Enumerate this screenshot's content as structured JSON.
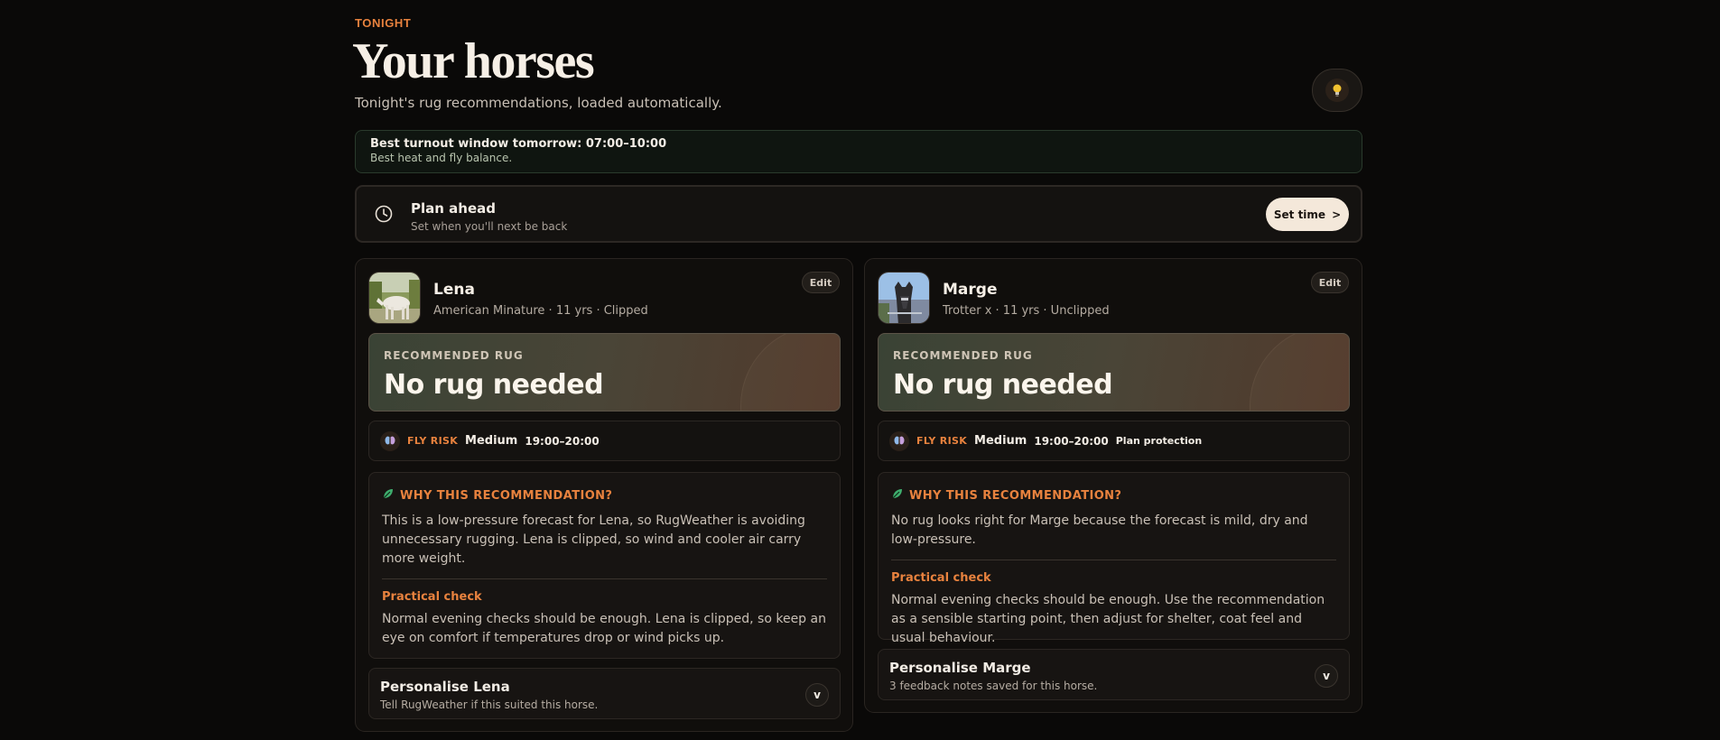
{
  "header": {
    "eyebrow": "TONIGHT",
    "title": "Your horses",
    "subtitle": "Tonight's rug recommendations, loaded automatically.",
    "tip_icon": "lightbulb-icon"
  },
  "turnout": {
    "title": "Best turnout window tomorrow: 07:00–10:00",
    "detail": "Best heat and fly balance."
  },
  "plan": {
    "icon": "clock-icon",
    "title": "Plan ahead",
    "detail": "Set when you'll next be back",
    "button_label": "Set time",
    "button_arrow": ">"
  },
  "horses": [
    {
      "name": "Lena",
      "meta": "American Minature · 11 yrs · Clipped",
      "edit_label": "Edit",
      "rec_label": "RECOMMENDED RUG",
      "rec_value": "No rug needed",
      "fly_label": "FLY RISK",
      "fly_level": "Medium",
      "fly_time": "19:00–20:00",
      "why_title": "WHY THIS RECOMMENDATION?",
      "why_text": "This is a low-pressure forecast for Lena, so RugWeather is avoiding unnecessary rugging. Lena is clipped, so wind and cooler air carry more weight.",
      "check_title": "Practical check",
      "check_text": "Normal evening checks should be enough. Lena is clipped, so keep an eye on comfort if temperatures drop or wind picks up.",
      "personalise_title": "Personalise Lena",
      "personalise_detail": "Tell RugWeather if this suited this horse.",
      "chevron": "v"
    },
    {
      "name": "Marge",
      "meta": "Trotter x · 11 yrs · Unclipped",
      "edit_label": "Edit",
      "rec_label": "RECOMMENDED RUG",
      "rec_value": "No rug needed",
      "fly_label": "FLY RISK",
      "fly_level": "Medium",
      "fly_time": "19:00–20:00",
      "fly_action": "Plan protection",
      "why_title": "WHY THIS RECOMMENDATION?",
      "why_text": "No rug looks right for Marge because the forecast is mild, dry and low-pressure.",
      "check_title": "Practical check",
      "check_text": "Normal evening checks should be enough. Use the recommendation as a sensible starting point, then adjust for shelter, coat feel and usual behaviour.",
      "personalise_title": "Personalise Marge",
      "personalise_detail": "3 feedback notes saved for this horse.",
      "chevron": "v"
    }
  ],
  "colors": {
    "background": "#0a0908",
    "accent": "#e8823e",
    "button_light": "#f4e8da",
    "turnout_bg": "#0f1510"
  }
}
